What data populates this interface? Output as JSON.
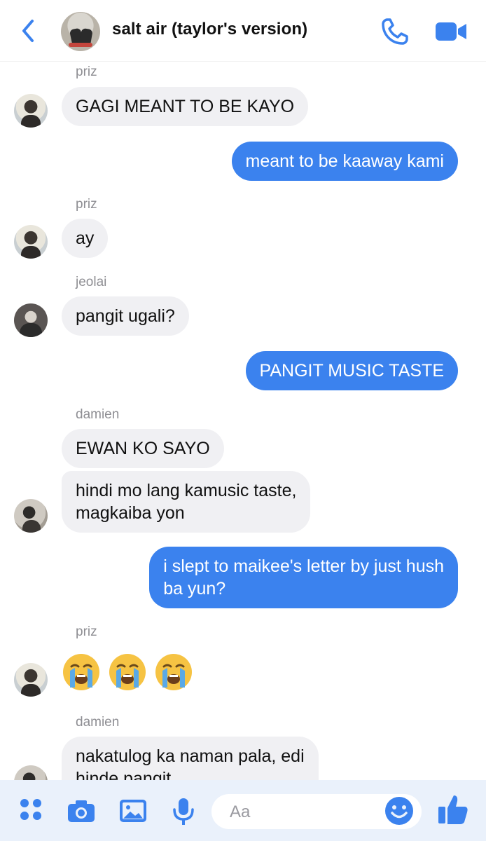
{
  "header": {
    "back_icon": "chevron-left-icon",
    "title": "salt air (taylor's version)",
    "call_icon": "phone-icon",
    "video_icon": "video-camera-icon"
  },
  "colors": {
    "accent": "#3b82ee",
    "incoming_bubble": "#f0f0f3",
    "outgoing_text": "#ffffff",
    "sender_label": "#8e8e93",
    "composer_bg": "#eaf1fb"
  },
  "messages": [
    {
      "sender": "priz",
      "direction": "in",
      "text": "GAGI MEANT TO BE KAYO"
    },
    {
      "direction": "out",
      "text": "meant to be kaaway kami"
    },
    {
      "sender": "priz",
      "direction": "in",
      "text": "ay"
    },
    {
      "sender": "jeolai",
      "direction": "in",
      "text": "pangit ugali?"
    },
    {
      "direction": "out",
      "text": "PANGIT MUSIC TASTE"
    },
    {
      "sender": "damien",
      "direction": "in",
      "text": "EWAN KO SAYO"
    },
    {
      "sender": "damien",
      "direction": "in",
      "lines": [
        "hindi mo lang kamusic taste,",
        "magkaiba yon"
      ]
    },
    {
      "direction": "out",
      "lines": [
        "i slept to maikee's letter by just hush",
        "ba yun?"
      ]
    },
    {
      "sender": "priz",
      "direction": "in",
      "emoji": [
        "loudly-crying-face",
        "loudly-crying-face",
        "loudly-crying-face"
      ]
    },
    {
      "sender": "damien",
      "direction": "in",
      "lines": [
        "nakatulog ka naman pala, edi",
        "hinde pangit"
      ]
    }
  ],
  "composer": {
    "placeholder": "Aa",
    "icons": [
      "apps-grid-icon",
      "camera-icon",
      "photo-icon",
      "microphone-icon",
      "emoji-icon",
      "thumbs-up-icon"
    ]
  }
}
